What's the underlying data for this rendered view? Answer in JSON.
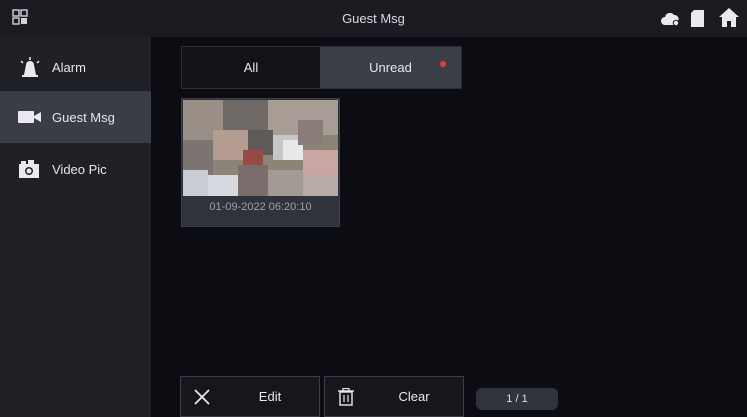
{
  "topbar": {
    "title": "Guest Msg",
    "icons": [
      "apps-icon",
      "cloud-icon",
      "sd-card-icon",
      "home-icon"
    ]
  },
  "sidebar": {
    "items": [
      {
        "label": "Alarm",
        "icon": "alarm-siren-icon",
        "active": false
      },
      {
        "label": "Guest Msg",
        "icon": "video-camera-icon",
        "active": true
      },
      {
        "label": "Video Pic",
        "icon": "camera-icon",
        "active": false
      }
    ]
  },
  "tabs": {
    "all_label": "All",
    "unread_label": "Unread",
    "unread_indicator_color": "#e23b3b",
    "selected": "Unread"
  },
  "messages": [
    {
      "timestamp": "01-09-2022 06:20:10"
    }
  ],
  "actions": {
    "edit_label": "Edit",
    "clear_label": "Clear"
  },
  "pagination": {
    "text": "1 / 1"
  },
  "colors": {
    "background": "#0b0d12",
    "sidebar_bg": "#1f2127",
    "active_item_bg": "#3a3d46",
    "accent_dot": "#e23b3b"
  }
}
